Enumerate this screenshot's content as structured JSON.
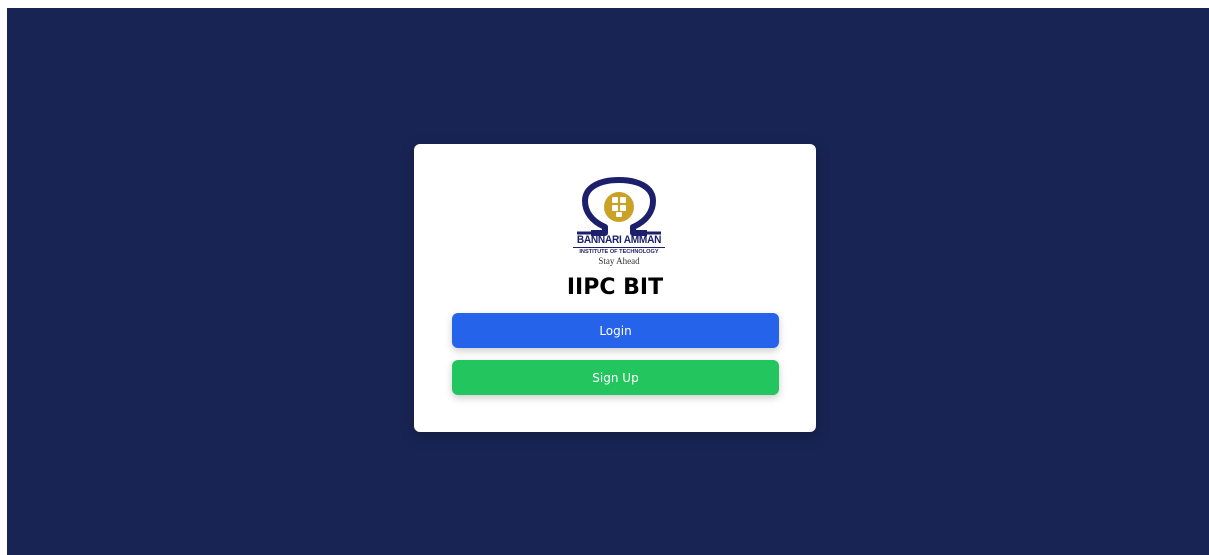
{
  "page": {
    "background_color": "#182454"
  },
  "card": {
    "logo": {
      "name": "BANNARI AMMAN",
      "subtitle": "INSTITUTE OF TECHNOLOGY",
      "tagline": "Stay Ahead",
      "colors": {
        "navy": "#1c1f6b",
        "gold": "#c9a227"
      }
    },
    "title": "IIPC BIT",
    "buttons": {
      "login": {
        "label": "Login",
        "color": "#2563eb"
      },
      "signup": {
        "label": "Sign Up",
        "color": "#22c55e"
      }
    }
  }
}
